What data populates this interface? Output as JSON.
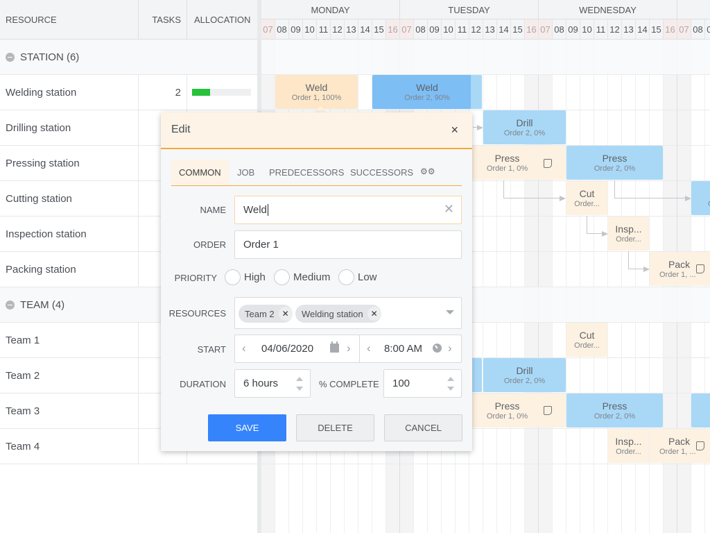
{
  "left_grid": {
    "headers": {
      "resource": "RESOURCE",
      "tasks": "TASKS",
      "allocation": "ALLOCATION"
    },
    "groups": [
      {
        "label": "STATION (6)"
      },
      {
        "label": "TEAM (4)"
      }
    ],
    "rows": [
      {
        "name": "Welding station",
        "tasks": "2",
        "allocation": 0.3
      },
      {
        "name": "Drilling station",
        "tasks": "",
        "allocation": null
      },
      {
        "name": "Pressing station",
        "tasks": "",
        "allocation": null
      },
      {
        "name": "Cutting station",
        "tasks": "",
        "allocation": null
      },
      {
        "name": "Inspection station",
        "tasks": "",
        "allocation": null
      },
      {
        "name": "Packing station",
        "tasks": "",
        "allocation": null
      },
      {
        "name": "Team 1",
        "tasks": "",
        "allocation": null
      },
      {
        "name": "Team 2",
        "tasks": "",
        "allocation": null
      },
      {
        "name": "Team 3",
        "tasks": "",
        "allocation": null
      },
      {
        "name": "Team 4",
        "tasks": "",
        "allocation": null
      }
    ],
    "allocation_color": "#27c13b"
  },
  "timeline": {
    "days": [
      "MONDAY",
      "TUESDAY",
      "WEDNESDAY",
      ""
    ],
    "hours": [
      "07",
      "08",
      "09",
      "10",
      "11",
      "12",
      "13",
      "14",
      "15",
      "16"
    ],
    "tasks": {
      "weld_o1": {
        "name": "Weld",
        "sub": "Order 1, 100%"
      },
      "weld_o2": {
        "name": "Weld",
        "sub": "Order 2, 90%",
        "progress": 0.9
      },
      "drill_o2": {
        "name": "Drill",
        "sub": "Order 2, 0%"
      },
      "press_o1": {
        "name": "Press",
        "sub": "Order 1, 0%"
      },
      "press_o2": {
        "name": "Press",
        "sub": "Order 2, 0%"
      },
      "cut_o1": {
        "name": "Cut",
        "sub": "Order..."
      },
      "cut_o2_partial": {
        "name": "",
        "sub": "O"
      },
      "insp_o1": {
        "name": "Insp...",
        "sub": "Order..."
      },
      "pack_o1": {
        "name": "Pack",
        "sub": "Order 1, ..."
      }
    },
    "colors": {
      "order1": "#fdf1e1",
      "order1_done": "#fde7c8",
      "order2": "#a9d8f7",
      "order2_progress": "#7dbef5"
    }
  },
  "dialog": {
    "title": "Edit",
    "close_label": "×",
    "tabs": [
      "COMMON",
      "JOB",
      "PREDECESSORS",
      "SUCCESSORS"
    ],
    "active_tab": "COMMON",
    "fields": {
      "name_label": "NAME",
      "name_value": "Weld",
      "order_label": "ORDER",
      "order_value": "Order 1",
      "priority_label": "PRIORITY",
      "priority_options": [
        "High",
        "Medium",
        "Low"
      ],
      "resources_label": "RESOURCES",
      "resources": [
        "Team 2",
        "Welding station"
      ],
      "start_label": "START",
      "start_date": "04/06/2020",
      "start_time": "8:00 AM",
      "duration_label": "DURATION",
      "duration_value": "6 hours",
      "complete_label": "% COMPLETE",
      "complete_value": "100"
    },
    "buttons": {
      "save": "SAVE",
      "delete": "DELETE",
      "cancel": "CANCEL"
    },
    "accent": "#f4a83a",
    "save_color": "#3584fc"
  }
}
